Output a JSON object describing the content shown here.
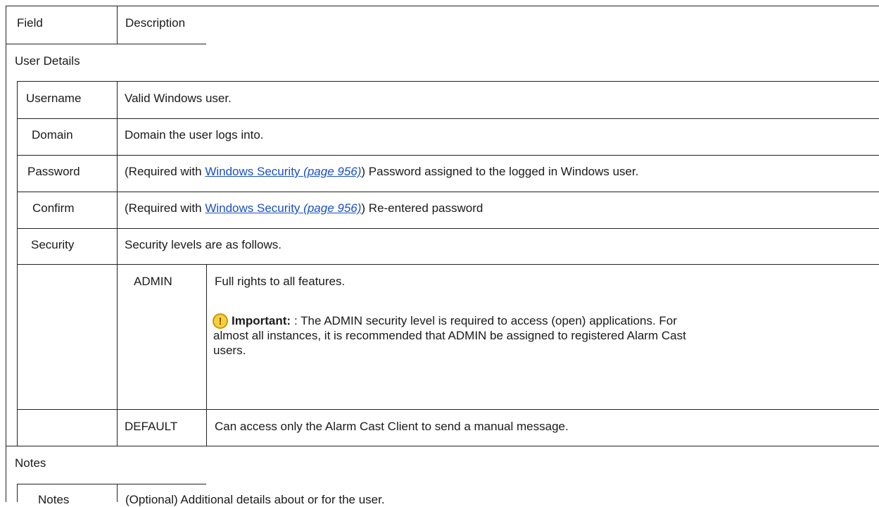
{
  "table": {
    "header": {
      "field": "Field",
      "description": "Description"
    },
    "sections": {
      "user_details": "User Details",
      "notes": "Notes"
    },
    "rows": {
      "username": {
        "field": "Username",
        "description": "Valid Windows user."
      },
      "domain": {
        "field": "Domain",
        "description": "Domain the user logs into."
      },
      "password": {
        "field": "Password",
        "prefix": "(Required with ",
        "link_text": "Windows Security",
        "link_page": "(page 956)",
        "suffix": ") Password assigned to the logged in Windows user."
      },
      "confirm": {
        "field": "Confirm",
        "prefix": "(Required with ",
        "link_text": "Windows Security",
        "link_page": "(page 956)",
        "suffix": ") Re-entered password"
      },
      "security": {
        "field": "Security",
        "description": "Security levels are as follows."
      },
      "admin": {
        "level": "ADMIN",
        "description": "Full rights to all features.",
        "note_label": "Important:",
        "note_line1": " : The ADMIN security level is required to access (open) applications. For",
        "note_line2": "almost all instances, it is recommended that ADMIN be assigned to registered Alarm Cast",
        "note_line3": "users."
      },
      "default": {
        "level": "DEFAULT",
        "description": "Can access only the Alarm Cast Client to send a manual message."
      },
      "notes": {
        "field": "Notes",
        "description": "(Optional) Additional details about or for the user."
      }
    },
    "icon": {
      "important": "exclamation-warning-icon",
      "glyph": "!"
    }
  }
}
